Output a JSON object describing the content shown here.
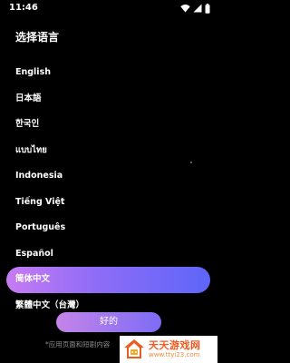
{
  "status_bar": {
    "time": "11:46",
    "icons": [
      "wifi-icon",
      "signal-icon",
      "battery-icon"
    ]
  },
  "page_title": "选择语言",
  "languages": [
    {
      "label": "English",
      "selected": false
    },
    {
      "label": "日本語",
      "selected": false
    },
    {
      "label": "한국인",
      "selected": false
    },
    {
      "label": "แบบไทย",
      "selected": false
    },
    {
      "label": "Indonesia",
      "selected": false
    },
    {
      "label": "Tiếng Việt",
      "selected": false
    },
    {
      "label": "Português",
      "selected": false
    },
    {
      "label": "Español",
      "selected": false
    },
    {
      "label": "简体中文",
      "selected": true
    },
    {
      "label": "繁體中文（台灣）",
      "selected": false
    }
  ],
  "confirm_button": "好的",
  "footnote": "*应用页面和短剧内容",
  "watermark": {
    "name": "天天游戏网",
    "url": "www.ttyi23.com"
  },
  "colors": {
    "background": "#000000",
    "selected_gradient_start": "#c77bf2",
    "selected_gradient_end": "#5e66f8",
    "watermark_accent": "#f05a1e"
  }
}
